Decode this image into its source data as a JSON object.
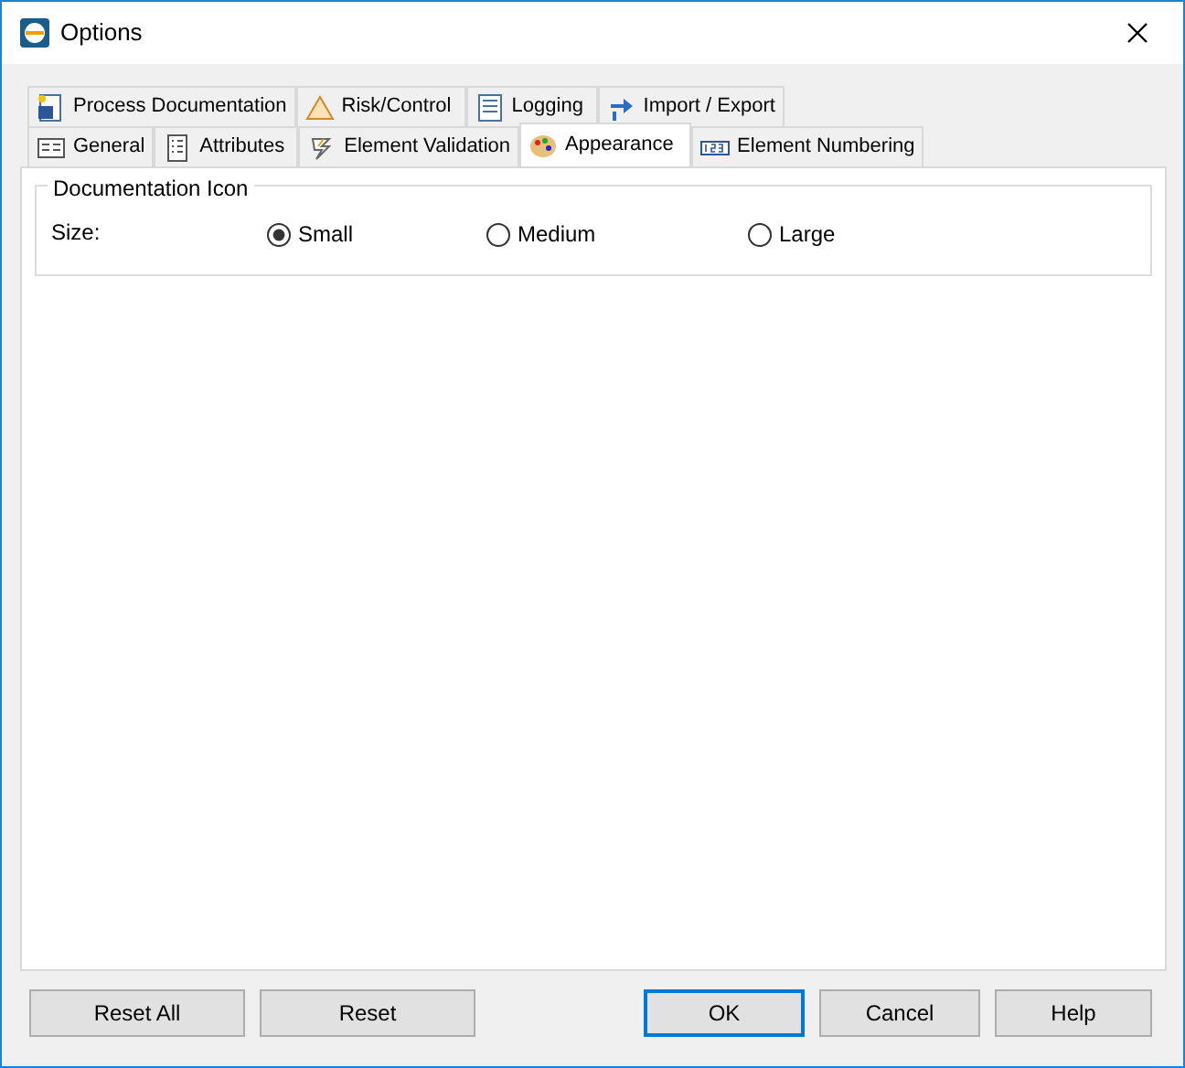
{
  "window": {
    "title": "Options"
  },
  "tab_rows": [
    [
      {
        "label": "Process Documentation",
        "selected": false
      },
      {
        "label": "Risk/Control",
        "selected": false
      },
      {
        "label": "Logging",
        "selected": false
      },
      {
        "label": "Import / Export",
        "selected": false
      }
    ],
    [
      {
        "label": "General",
        "selected": false
      },
      {
        "label": "Attributes",
        "selected": false
      },
      {
        "label": "Element Validation",
        "selected": false
      },
      {
        "label": "Appearance",
        "selected": true
      },
      {
        "label": "Element Numbering",
        "selected": false
      }
    ]
  ],
  "group": {
    "title": "Documentation Icon",
    "label": "Size:",
    "options": [
      {
        "label": "Small",
        "selected": true
      },
      {
        "label": "Medium",
        "selected": false
      },
      {
        "label": "Large",
        "selected": false
      }
    ]
  },
  "buttons": [
    {
      "label": "Reset All",
      "default": false
    },
    {
      "label": "Reset",
      "default": false
    },
    {
      "label": "OK",
      "default": true
    },
    {
      "label": "Cancel",
      "default": false
    },
    {
      "label": "Help",
      "default": false
    }
  ]
}
